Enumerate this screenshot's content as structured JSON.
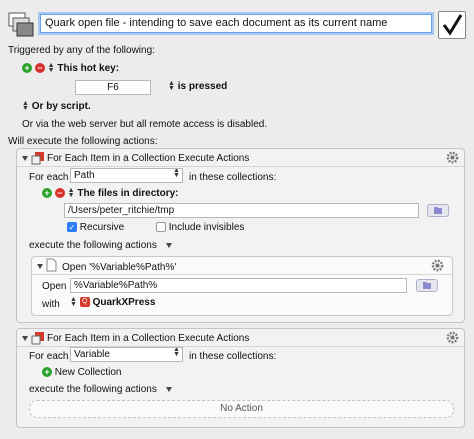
{
  "macro": {
    "title": "Quark open file - intending to save each document as its current name",
    "enabled_check": "✓"
  },
  "triggers": {
    "heading": "Triggered by any of the following:",
    "hotkey_label": "This hot key:",
    "hotkey_value": "F6",
    "hotkey_state": "is pressed",
    "or_by_script": "Or by script.",
    "web_server_note": "Or via the web server but all remote access is disabled."
  },
  "actions_heading": "Will execute the following actions:",
  "action1": {
    "title": "For Each Item in a Collection Execute Actions",
    "for_each_label": "For each",
    "variable": "Path",
    "in_collections": "in these collections:",
    "files_in_directory": "The files in directory:",
    "directory": "/Users/peter_ritchie/tmp",
    "recursive_label": "Recursive",
    "recursive_checked": true,
    "include_invisibles_label": "Include invisibles",
    "include_invisibles_checked": false,
    "execute_label": "execute the following actions",
    "sub_action": {
      "title": "Open '%Variable%Path%'",
      "open_label": "Open",
      "open_value": "%Variable%Path%",
      "with_label": "with",
      "app_name": "QuarkXPress"
    }
  },
  "action2": {
    "title": "For Each Item in a Collection Execute Actions",
    "for_each_label": "For each",
    "variable": "Variable",
    "in_collections": "in these collections:",
    "new_collection": "New Collection",
    "execute_label": "execute the following actions",
    "no_action": "No Action"
  },
  "colors": {
    "accent": "#2e7cf6",
    "plus": "#2aa12a",
    "minus": "#d9302a",
    "app_icon": "#d33a2c"
  }
}
